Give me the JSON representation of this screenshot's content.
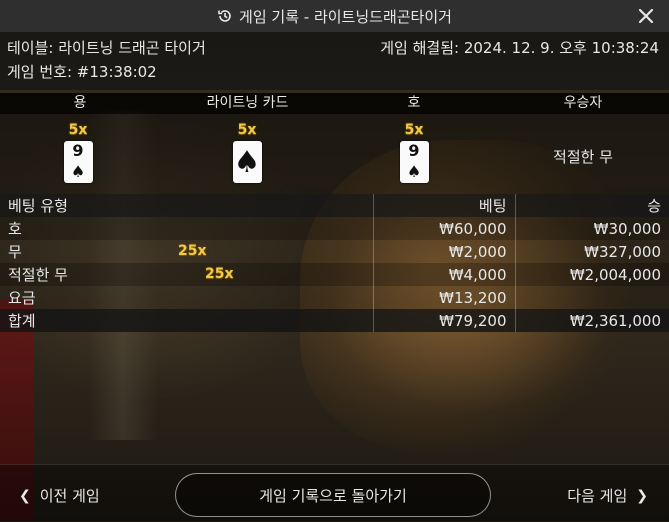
{
  "header": {
    "title": "게임 기록 - 라이트닝드래곤타이거"
  },
  "info": {
    "table": "테이블: 라이트닝 드래곤 타이거",
    "resolved": "게임 해결됨: 2024. 12. 9. 오후 10:38:24",
    "game_no": "게임 번호: #13:38:02"
  },
  "results": {
    "columns": [
      "용",
      "라이트닝 카드",
      "호",
      "우승자"
    ],
    "dragon": {
      "multiplier": "5x",
      "rank": "9",
      "suit": "♠"
    },
    "lightning": {
      "multiplier": "5x",
      "rank": "",
      "suit": "♠"
    },
    "tiger": {
      "multiplier": "5x",
      "rank": "9",
      "suit": "♠"
    },
    "winner": "적절한 무"
  },
  "bets": {
    "headers": {
      "type": "베팅 유형",
      "bet": "베팅",
      "win": "승"
    },
    "rows": [
      {
        "type": "호",
        "multiplier": "",
        "bet": "₩60,000",
        "win": "₩30,000"
      },
      {
        "type": "무",
        "multiplier": "25x",
        "bet": "₩2,000",
        "win": "₩327,000"
      },
      {
        "type": "적절한 무",
        "multiplier": "25x",
        "bet": "₩4,000",
        "win": "₩2,004,000"
      },
      {
        "type": "요금",
        "multiplier": "",
        "bet": "₩13,200",
        "win": ""
      }
    ],
    "total": {
      "type": "합계",
      "bet": "₩79,200",
      "win": "₩2,361,000"
    }
  },
  "footer": {
    "prev": "이전 게임",
    "back": "게임 기록으로 돌아가기",
    "next": "다음 게임"
  },
  "colors": {
    "multiplier": "#f2c94c",
    "header_bg": "#2f2f2f"
  },
  "icons": {
    "title": "history-icon",
    "close": "close-icon",
    "prev": "chevron-left-icon",
    "next": "chevron-right-icon"
  }
}
